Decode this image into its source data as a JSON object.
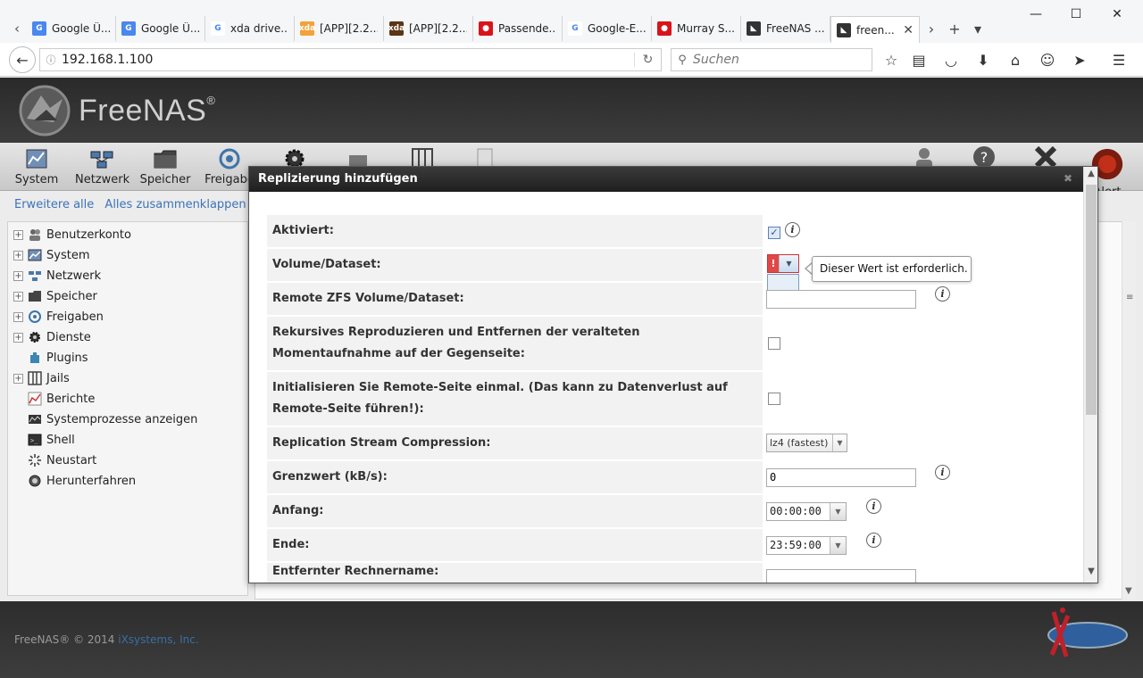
{
  "browser": {
    "tabs": [
      {
        "title": "Google Ü...",
        "icon": "google-translate-icon",
        "color": "#4a87ee",
        "glyph": "G"
      },
      {
        "title": "Google Ü...",
        "icon": "google-translate-icon",
        "color": "#4a87ee",
        "glyph": "G"
      },
      {
        "title": "xda drive...",
        "icon": "google-icon",
        "color": "#ffffff",
        "glyph": "G"
      },
      {
        "title": "[APP][2.2...",
        "icon": "xda-icon",
        "color": "#f2a23b",
        "glyph": "xda"
      },
      {
        "title": "[APP][2.2...",
        "icon": "xda-dark-icon",
        "color": "#5b3515",
        "glyph": "xda"
      },
      {
        "title": "Passende...",
        "icon": "red-dot-icon",
        "color": "#d8141a",
        "glyph": "●"
      },
      {
        "title": "Google-E...",
        "icon": "google-icon",
        "color": "#ffffff",
        "glyph": "G"
      },
      {
        "title": "Murray S...",
        "icon": "red-dot-icon",
        "color": "#d8141a",
        "glyph": "●"
      },
      {
        "title": "FreeNAS ...",
        "icon": "freenas-shark-icon",
        "color": "#333333",
        "glyph": "◣"
      },
      {
        "title": "freen...",
        "icon": "freenas-shark-icon",
        "color": "#333333",
        "glyph": "◣",
        "active": true
      }
    ],
    "url": "192.168.1.100",
    "search_placeholder": "Suchen"
  },
  "freenas": {
    "brand": "FreeNAS",
    "nav": [
      {
        "label": "System",
        "icon": "system-chart-icon"
      },
      {
        "label": "Netzwerk",
        "icon": "network-icon"
      },
      {
        "label": "Speicher",
        "icon": "storage-folder-icon"
      },
      {
        "label": "Freigabe",
        "icon": "sharing-icon"
      }
    ],
    "nav_right": [
      {
        "label": "Alert",
        "icon": "alert-icon"
      }
    ],
    "tree_links": {
      "expand": "Erweitere alle",
      "collapse": "Alles zusammenklappen"
    },
    "tree": [
      {
        "label": "Benutzerkonto",
        "expandable": true,
        "icon": "users-icon"
      },
      {
        "label": "System",
        "expandable": true,
        "icon": "system-chart-icon"
      },
      {
        "label": "Netzwerk",
        "expandable": true,
        "icon": "network-icon"
      },
      {
        "label": "Speicher",
        "expandable": true,
        "icon": "storage-folder-icon"
      },
      {
        "label": "Freigaben",
        "expandable": true,
        "icon": "sharing-icon"
      },
      {
        "label": "Dienste",
        "expandable": true,
        "icon": "services-gear-icon"
      },
      {
        "label": "Plugins",
        "expandable": false,
        "icon": "plugin-icon"
      },
      {
        "label": "Jails",
        "expandable": true,
        "icon": "jails-icon"
      },
      {
        "label": "Berichte",
        "expandable": false,
        "icon": "reports-icon"
      },
      {
        "label": "Systemprozesse anzeigen",
        "expandable": false,
        "icon": "process-icon"
      },
      {
        "label": "Shell",
        "expandable": false,
        "icon": "shell-icon"
      },
      {
        "label": "Neustart",
        "expandable": false,
        "icon": "reboot-icon"
      },
      {
        "label": "Herunterfahren",
        "expandable": false,
        "icon": "shutdown-icon"
      }
    ],
    "footer": {
      "copyright": "FreeNAS® © 2014 ",
      "company": "iXsystems, Inc."
    }
  },
  "dialog": {
    "title": "Replizierung hinzufügen",
    "fields": {
      "enabled": {
        "label": "Aktiviert:",
        "checked": true
      },
      "volume": {
        "label": "Volume/Dataset:",
        "error": "Dieser Wert ist erforderlich."
      },
      "remote_volume": {
        "label": "Remote ZFS Volume/Dataset:",
        "value": ""
      },
      "recursive": {
        "label": "Rekursives Reproduzieren und Entfernen der veralteten Momentaufnahme auf der Gegenseite:",
        "checked": false
      },
      "initialize": {
        "label": "Initialisieren Sie Remote-Seite einmal. (Das kann zu Datenverlust auf Remote-Seite führen!):",
        "checked": false
      },
      "compression": {
        "label": "Replication Stream Compression:",
        "value": "lz4 (fastest)"
      },
      "limit": {
        "label": "Grenzwert (kB/s):",
        "value": "0"
      },
      "begin": {
        "label": "Anfang:",
        "value": "00:00:00"
      },
      "end": {
        "label": "Ende:",
        "value": "23:59:00"
      },
      "remote_host": {
        "label": "Entfernter Rechnername:",
        "value": ""
      }
    }
  }
}
